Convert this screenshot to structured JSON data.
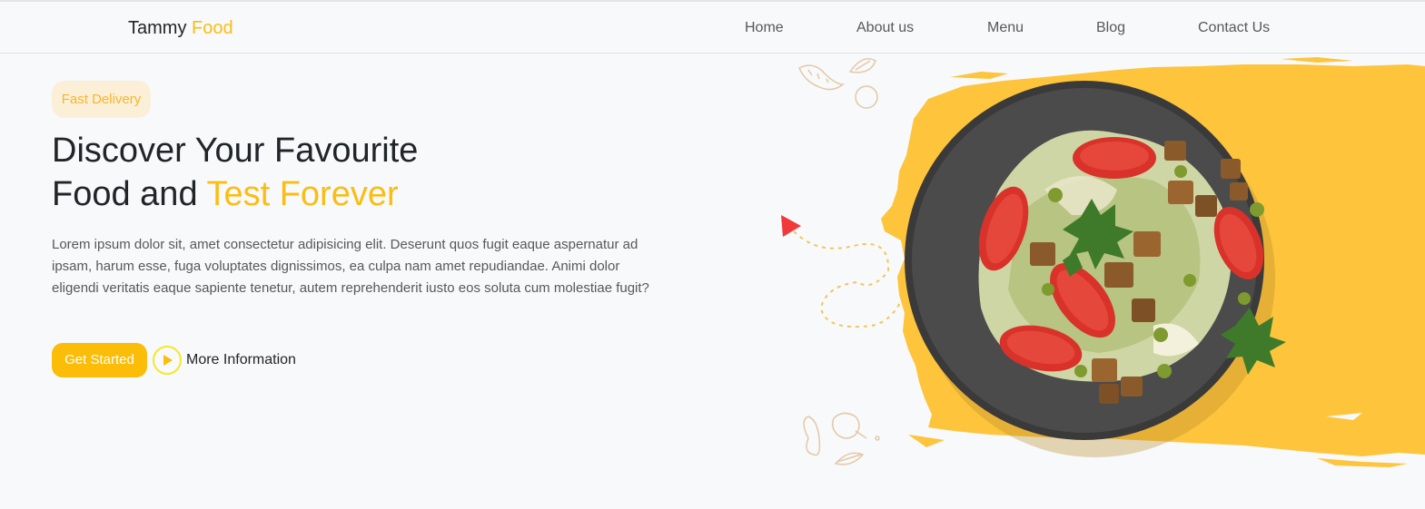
{
  "brand": {
    "name": "Tammy",
    "accent": "Food"
  },
  "nav": {
    "items": [
      {
        "label": "Home"
      },
      {
        "label": "About us"
      },
      {
        "label": "Menu"
      },
      {
        "label": "Blog"
      },
      {
        "label": "Contact Us"
      }
    ]
  },
  "hero": {
    "badge": "Fast Delivery",
    "headline_line1": "Discover Your Favourite",
    "headline_line2_plain": "Food and ",
    "headline_line2_accent": "Test Forever",
    "description": "Lorem ipsum dolor sit, amet consectetur adipisicing elit. Deserunt quos fugit eaque aspernatur ad ipsam, harum esse, fuga voluptates dignissimos, ea culpa nam amet repudiandae. Animi dolor eligendi veritatis eaque sapiente tenetur, autem reprehenderit iusto eos soluta cum molestiae fugit?",
    "cta_primary": "Get Started",
    "cta_secondary": "More Information"
  },
  "icons": {
    "play": "play-icon",
    "arrow": "red-arrow-icon",
    "doodles": [
      "shrimp-icon",
      "lemon-icon",
      "tomato-icon",
      "pepper-icon",
      "chicken-leg-icon",
      "leaf-icon"
    ],
    "plate": "salad-plate-image"
  },
  "colors": {
    "accent": "#fbbd14",
    "button": "#fbbd08",
    "badge_bg": "#fcefd7",
    "play_ring": "#f4e82a",
    "splash": "#fdc43c",
    "arrow": "#f0393a"
  }
}
